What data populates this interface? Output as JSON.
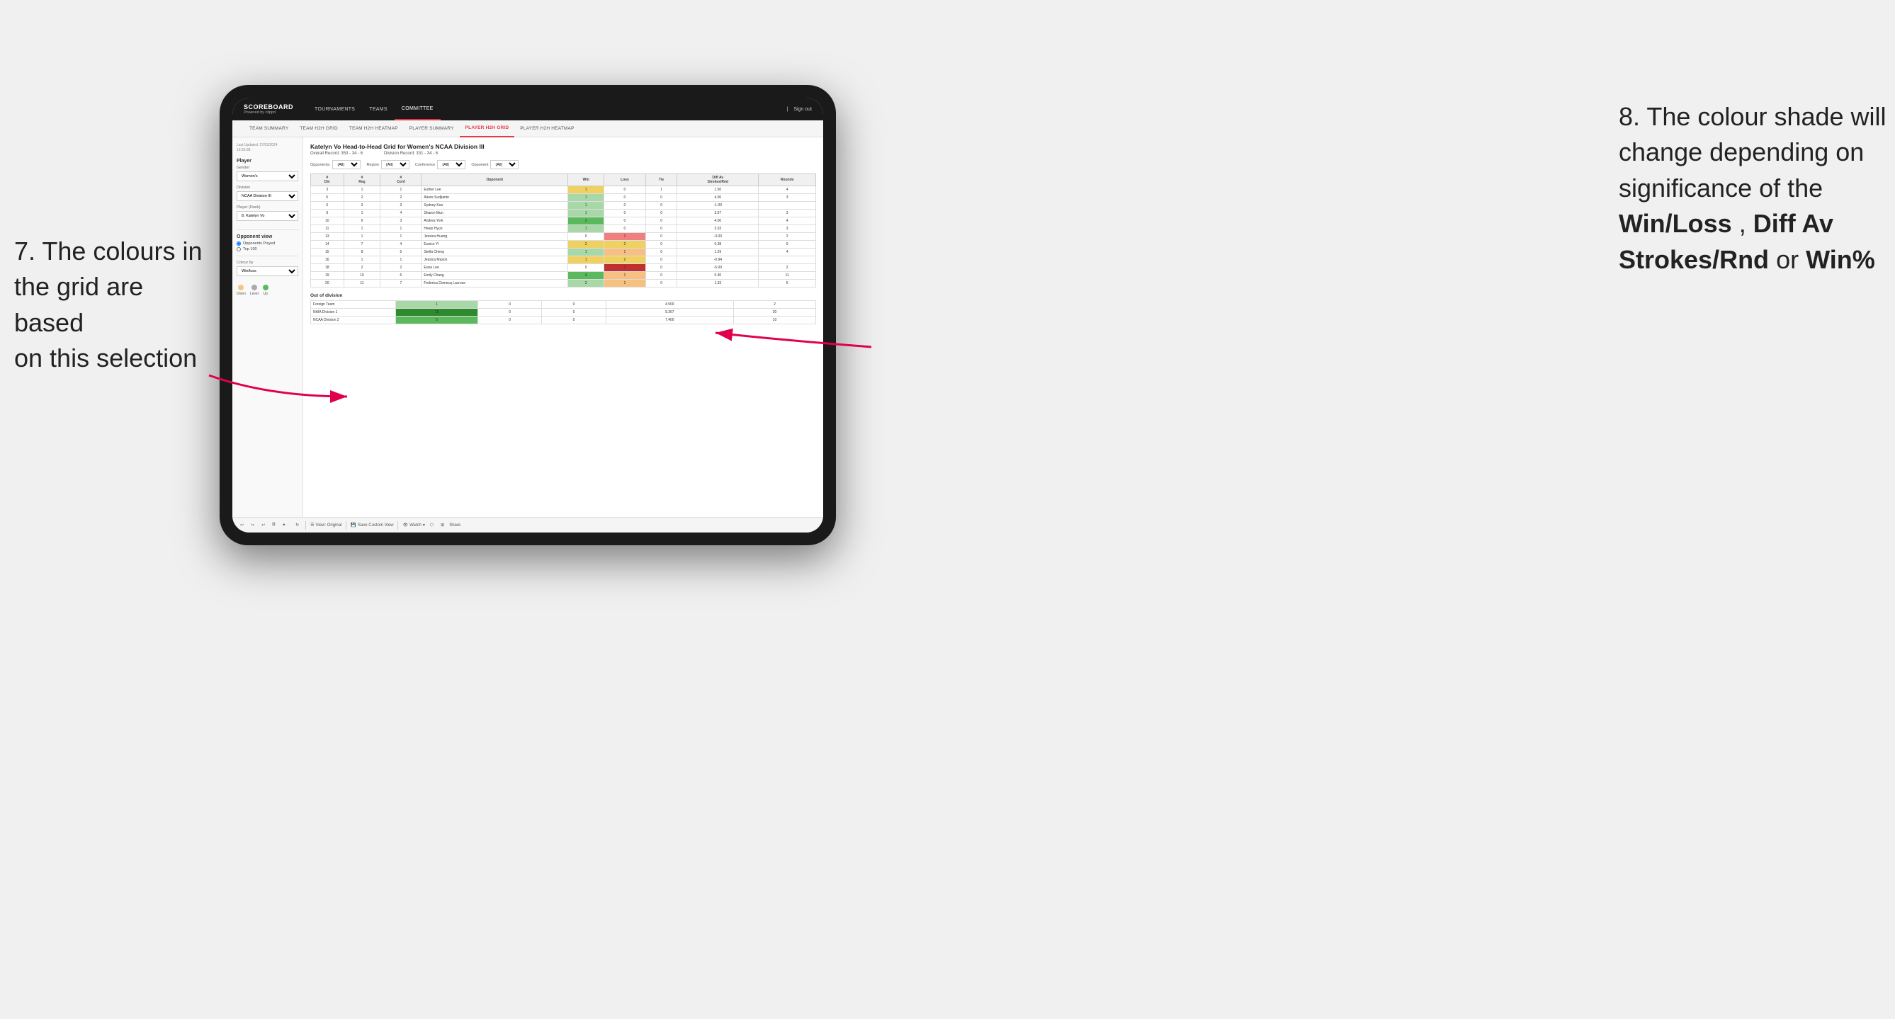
{
  "annotation_left": {
    "line1": "7. The colours in",
    "line2": "the grid are based",
    "line3": "on this selection"
  },
  "annotation_right": {
    "intro": "8. The colour shade will change depending on significance of the ",
    "bold1": "Win/Loss",
    "comma": ", ",
    "bold2": "Diff Av Strokes/Rnd",
    "or": " or ",
    "bold3": "Win%"
  },
  "nav": {
    "logo": "SCOREBOARD",
    "logo_sub": "Powered by clippd",
    "items": [
      "TOURNAMENTS",
      "TEAMS",
      "COMMITTEE"
    ],
    "sign_out": "Sign out"
  },
  "sub_nav": {
    "items": [
      "TEAM SUMMARY",
      "TEAM H2H GRID",
      "TEAM H2H HEATMAP",
      "PLAYER SUMMARY",
      "PLAYER H2H GRID",
      "PLAYER H2H HEATMAP"
    ]
  },
  "sidebar": {
    "timestamp_label": "Last Updated: 27/03/2024",
    "timestamp_time": "16:55:38",
    "player_section": "Player",
    "gender_label": "Gender",
    "gender_value": "Women's",
    "division_label": "Division",
    "division_value": "NCAA Division III",
    "player_rank_label": "Player (Rank)",
    "player_rank_value": "8. Katelyn Vo",
    "opponent_view_label": "Opponent view",
    "radio1": "Opponents Played",
    "radio2": "Top 100",
    "colour_by_label": "Colour by",
    "colour_by_value": "Win/loss",
    "legend": {
      "down": "Down",
      "level": "Level",
      "up": "Up"
    }
  },
  "grid": {
    "title": "Katelyn Vo Head-to-Head Grid for Women's NCAA Division III",
    "overall_record_label": "Overall Record:",
    "overall_record_value": "353 - 34 - 6",
    "division_record_label": "Division Record:",
    "division_record_value": "331 - 34 - 6",
    "opponents_label": "Opponents:",
    "opponents_value": "(All)",
    "region_label": "Region",
    "region_value": "(All)",
    "conference_label": "Conference",
    "conference_value": "(All)",
    "opponent_label": "Opponent",
    "opponent_value": "(All)",
    "col_headers": [
      "#\nDiv",
      "#\nReg",
      "#\nConf",
      "Opponent",
      "Win",
      "Loss",
      "Tie",
      "Diff Av\nStrokes/Rnd",
      "Rounds"
    ],
    "rows": [
      {
        "div": "3",
        "reg": "1",
        "conf": "1",
        "opponent": "Esther Lee",
        "win": "1",
        "loss": "0",
        "tie": "1",
        "diff": "1.50",
        "rounds": "4",
        "win_color": "yellow",
        "loss_color": "white",
        "tie_color": "white"
      },
      {
        "div": "5",
        "reg": "2",
        "conf": "2",
        "opponent": "Alexis Sudjianto",
        "win": "1",
        "loss": "0",
        "tie": "0",
        "diff": "4.00",
        "rounds": "3",
        "win_color": "green_light",
        "loss_color": "white",
        "tie_color": "white"
      },
      {
        "div": "6",
        "reg": "3",
        "conf": "3",
        "opponent": "Sydney Kuo",
        "win": "1",
        "loss": "0",
        "tie": "0",
        "diff": "-1.00",
        "rounds": "",
        "win_color": "green_light",
        "loss_color": "white",
        "tie_color": "white"
      },
      {
        "div": "9",
        "reg": "1",
        "conf": "4",
        "opponent": "Sharon Mun",
        "win": "1",
        "loss": "0",
        "tie": "0",
        "diff": "3.67",
        "rounds": "3",
        "win_color": "green_light",
        "loss_color": "white",
        "tie_color": "white"
      },
      {
        "div": "10",
        "reg": "6",
        "conf": "3",
        "opponent": "Andrea York",
        "win": "2",
        "loss": "0",
        "tie": "0",
        "diff": "4.00",
        "rounds": "4",
        "win_color": "green_med",
        "loss_color": "white",
        "tie_color": "white"
      },
      {
        "div": "11",
        "reg": "1",
        "conf": "1",
        "opponent": "Heejo Hyun",
        "win": "1",
        "loss": "0",
        "tie": "0",
        "diff": "3.33",
        "rounds": "3",
        "win_color": "green_light",
        "loss_color": "white",
        "tie_color": "white"
      },
      {
        "div": "13",
        "reg": "1",
        "conf": "1",
        "opponent": "Jessica Huang",
        "win": "0",
        "loss": "1",
        "tie": "0",
        "diff": "-3.00",
        "rounds": "2",
        "win_color": "white",
        "loss_color": "red_light",
        "tie_color": "white"
      },
      {
        "div": "14",
        "reg": "7",
        "conf": "4",
        "opponent": "Eunice Yi",
        "win": "2",
        "loss": "2",
        "tie": "0",
        "diff": "0.38",
        "rounds": "9",
        "win_color": "yellow",
        "loss_color": "yellow",
        "tie_color": "white"
      },
      {
        "div": "15",
        "reg": "8",
        "conf": "5",
        "opponent": "Stella Cheng",
        "win": "1",
        "loss": "1",
        "tie": "0",
        "diff": "1.29",
        "rounds": "4",
        "win_color": "green_light",
        "loss_color": "orange",
        "tie_color": "white"
      },
      {
        "div": "16",
        "reg": "1",
        "conf": "1",
        "opponent": "Jessica Mason",
        "win": "1",
        "loss": "2",
        "tie": "0",
        "diff": "-0.94",
        "rounds": "",
        "win_color": "yellow",
        "loss_color": "yellow",
        "tie_color": "white"
      },
      {
        "div": "18",
        "reg": "2",
        "conf": "2",
        "opponent": "Euna Lee",
        "win": "0",
        "loss": "2",
        "tie": "0",
        "diff": "-5.00",
        "rounds": "2",
        "win_color": "white",
        "loss_color": "red_dark",
        "tie_color": "white"
      },
      {
        "div": "19",
        "reg": "10",
        "conf": "6",
        "opponent": "Emily Chang",
        "win": "4",
        "loss": "1",
        "tie": "0",
        "diff": "0.30",
        "rounds": "11",
        "win_color": "green_med",
        "loss_color": "orange",
        "tie_color": "white"
      },
      {
        "div": "20",
        "reg": "11",
        "conf": "7",
        "opponent": "Federica Domecq Lacroze",
        "win": "2",
        "loss": "1",
        "tie": "0",
        "diff": "1.33",
        "rounds": "6",
        "win_color": "green_light",
        "loss_color": "orange_light",
        "tie_color": "white"
      }
    ],
    "out_of_division_label": "Out of division",
    "ood_rows": [
      {
        "opponent": "Foreign Team",
        "win": "1",
        "loss": "0",
        "tie": "0",
        "diff": "4.500",
        "rounds": "2",
        "win_color": "green_light"
      },
      {
        "opponent": "NAIA Division 1",
        "win": "15",
        "loss": "0",
        "tie": "0",
        "diff": "9.267",
        "rounds": "30",
        "win_color": "green_dark"
      },
      {
        "opponent": "NCAA Division 2",
        "win": "5",
        "loss": "0",
        "tie": "0",
        "diff": "7.400",
        "rounds": "10",
        "win_color": "green_med"
      }
    ]
  },
  "toolbar": {
    "view_original": "View: Original",
    "save_custom": "Save Custom View",
    "watch": "Watch",
    "share": "Share"
  },
  "colors": {
    "accent": "#e63946",
    "green_dark": "#2d8a2d",
    "green_med": "#5cb85c",
    "green_light": "#a8d8a8",
    "yellow": "#f0d060",
    "orange": "#f5a050",
    "orange_light": "#f5c080",
    "red_light": "#f08080",
    "red_dark": "#c03030"
  }
}
